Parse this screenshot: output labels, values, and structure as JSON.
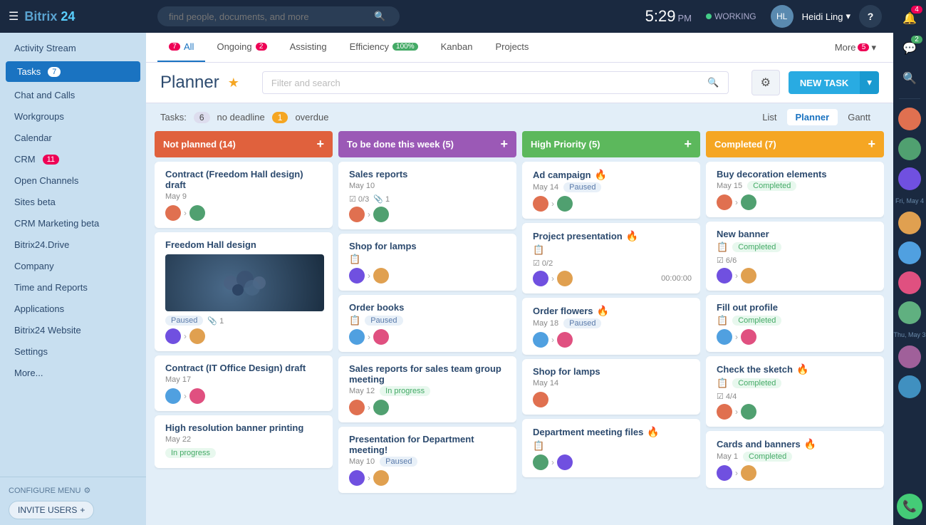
{
  "brand": {
    "name_part1": "Bitrix",
    "name_part2": "24"
  },
  "topbar": {
    "search_placeholder": "find people, documents, and more",
    "time": "5:29",
    "ampm": "PM",
    "status": "WORKING",
    "user_name": "Heidi Ling"
  },
  "sidebar": {
    "items": [
      {
        "label": "Activity Stream",
        "id": "activity-stream",
        "badge": null
      },
      {
        "label": "Tasks",
        "id": "tasks",
        "badge": "7"
      },
      {
        "label": "Chat and Calls",
        "id": "chat-and-calls",
        "badge": null
      },
      {
        "label": "Workgroups",
        "id": "workgroups",
        "badge": null
      },
      {
        "label": "Calendar",
        "id": "calendar",
        "badge": null
      },
      {
        "label": "CRM",
        "id": "crm",
        "badge": "11"
      },
      {
        "label": "Open Channels",
        "id": "open-channels",
        "badge": null
      },
      {
        "label": "Sites beta",
        "id": "sites",
        "badge": null
      },
      {
        "label": "CRM Marketing beta",
        "id": "crm-marketing",
        "badge": null
      },
      {
        "label": "Bitrix24.Drive",
        "id": "bitrix24-drive",
        "badge": null
      },
      {
        "label": "Company",
        "id": "company",
        "badge": null
      },
      {
        "label": "Time and Reports",
        "id": "time-and-reports",
        "badge": null
      },
      {
        "label": "Applications",
        "id": "applications",
        "badge": null
      },
      {
        "label": "Bitrix24 Website",
        "id": "bitrix24-website",
        "badge": null
      },
      {
        "label": "Settings",
        "id": "settings",
        "badge": null
      },
      {
        "label": "More...",
        "id": "more",
        "badge": null
      }
    ],
    "configure_menu": "CONFIGURE MENU",
    "invite_users": "INVITE USERS"
  },
  "tabs": [
    {
      "label": "All",
      "id": "all",
      "badge": "7",
      "badge_color": "red",
      "active": true
    },
    {
      "label": "Ongoing",
      "id": "ongoing",
      "badge": "2",
      "badge_color": "red"
    },
    {
      "label": "Assisting",
      "id": "assisting",
      "badge": null
    },
    {
      "label": "Efficiency",
      "id": "efficiency",
      "badge": "100%",
      "badge_color": "green"
    },
    {
      "label": "Kanban",
      "id": "kanban",
      "badge": null
    },
    {
      "label": "Projects",
      "id": "projects",
      "badge": null
    },
    {
      "label": "More",
      "id": "more",
      "badge": "5",
      "badge_color": "red"
    }
  ],
  "planner": {
    "title": "Planner",
    "filter_placeholder": "Filter and search",
    "new_task_label": "NEW TASK"
  },
  "stats": {
    "tasks_label": "Tasks:",
    "no_deadline": "6",
    "no_deadline_label": "no deadline",
    "overdue": "1",
    "overdue_label": "overdue"
  },
  "view_tabs": [
    "List",
    "Planner",
    "Gantt"
  ],
  "columns": [
    {
      "id": "not-planned",
      "title": "Not planned",
      "count": 14,
      "color": "col-orange",
      "cards": [
        {
          "id": "c1",
          "title": "Contract (Freedom Hall design) draft",
          "date": "May 9",
          "status": null,
          "avatars": [
            "av1",
            "av2"
          ],
          "has_arrow": true,
          "check": null,
          "clip": null,
          "timer": null,
          "fire": false,
          "img": false
        },
        {
          "id": "c2",
          "title": "Freedom Hall design",
          "date": "",
          "status": "Paused",
          "status_type": "paused",
          "avatars": [
            "av2",
            "av3"
          ],
          "has_arrow": true,
          "check": null,
          "clip": "1",
          "timer": null,
          "fire": false,
          "img": true
        },
        {
          "id": "c3",
          "title": "Contract (IT Office Design) draft",
          "date": "May 17",
          "status": null,
          "avatars": [
            "av4",
            "av5"
          ],
          "has_arrow": true,
          "check": null,
          "clip": null,
          "timer": null,
          "fire": false,
          "img": false
        },
        {
          "id": "c4",
          "title": "High resolution banner printing",
          "date": "May 22",
          "status": "In progress",
          "status_type": "progress",
          "avatars": [],
          "has_arrow": false,
          "check": null,
          "clip": null,
          "timer": null,
          "fire": false,
          "img": false
        }
      ]
    },
    {
      "id": "to-be-done",
      "title": "To be done this week",
      "count": 5,
      "color": "col-purple",
      "cards": [
        {
          "id": "c5",
          "title": "Sales reports",
          "date": "May 10",
          "status": null,
          "avatars": [
            "av1",
            "av2"
          ],
          "has_arrow": true,
          "check": "0/3",
          "clip": "1",
          "timer": null,
          "fire": false,
          "img": false
        },
        {
          "id": "c6",
          "title": "Shop for lamps",
          "date": "",
          "status": null,
          "avatars": [
            "av3",
            "av4"
          ],
          "has_arrow": true,
          "check": null,
          "clip": null,
          "timer": null,
          "fire": false,
          "img": false
        },
        {
          "id": "c7",
          "title": "Order books",
          "date": "",
          "status": "Paused",
          "status_type": "paused",
          "avatars": [
            "av5",
            "av6"
          ],
          "has_arrow": true,
          "check": null,
          "clip": null,
          "timer": null,
          "fire": false,
          "img": false
        },
        {
          "id": "c8",
          "title": "Sales reports for sales team group meeting",
          "date": "May 12",
          "status": "In progress",
          "status_type": "progress",
          "avatars": [
            "av1",
            "av2"
          ],
          "has_arrow": true,
          "check": null,
          "clip": null,
          "timer": null,
          "fire": false,
          "img": false
        },
        {
          "id": "c9",
          "title": "Presentation for Department meeting!",
          "date": "May 10",
          "status": "Paused",
          "status_type": "paused",
          "avatars": [
            "av3",
            "av4"
          ],
          "has_arrow": true,
          "check": null,
          "clip": null,
          "timer": null,
          "fire": false,
          "img": false
        }
      ]
    },
    {
      "id": "high-priority",
      "title": "High Priority",
      "count": 5,
      "color": "col-green",
      "cards": [
        {
          "id": "c10",
          "title": "Ad campaign",
          "date": "May 14",
          "status": "Paused",
          "status_type": "paused",
          "avatars": [
            "av1",
            "av2"
          ],
          "has_arrow": true,
          "check": null,
          "clip": null,
          "timer": null,
          "fire": true,
          "img": false
        },
        {
          "id": "c11",
          "title": "Project presentation",
          "date": "",
          "status": null,
          "avatars": [
            "av3",
            "av4"
          ],
          "has_arrow": true,
          "check": "0/2",
          "clip": null,
          "timer": "00:00:00",
          "fire": true,
          "img": false
        },
        {
          "id": "c12",
          "title": "Order flowers",
          "date": "May 18",
          "status": "Paused",
          "status_type": "paused",
          "avatars": [
            "av5",
            "av6"
          ],
          "has_arrow": true,
          "check": null,
          "clip": null,
          "timer": null,
          "fire": true,
          "img": false
        },
        {
          "id": "c13",
          "title": "Shop for lamps",
          "date": "May 14",
          "status": null,
          "avatars": [
            "av1"
          ],
          "has_arrow": false,
          "check": null,
          "clip": null,
          "timer": null,
          "fire": false,
          "img": false
        },
        {
          "id": "c14",
          "title": "Department meeting files",
          "date": "",
          "status": null,
          "avatars": [
            "av2",
            "av3"
          ],
          "has_arrow": true,
          "check": null,
          "clip": null,
          "timer": null,
          "fire": true,
          "img": false
        }
      ]
    },
    {
      "id": "completed",
      "title": "Completed",
      "count": 7,
      "color": "col-yellow",
      "cards": [
        {
          "id": "c15",
          "title": "Buy decoration elements",
          "date": "May 15",
          "status": "Completed",
          "status_type": "completed",
          "avatars": [
            "av1",
            "av2"
          ],
          "has_arrow": true,
          "check": null,
          "clip": null,
          "timer": null,
          "fire": false,
          "img": false
        },
        {
          "id": "c16",
          "title": "New banner",
          "date": "",
          "status": "Completed",
          "status_type": "completed",
          "avatars": [
            "av3",
            "av4"
          ],
          "has_arrow": true,
          "check": "6/6",
          "clip": null,
          "timer": null,
          "fire": false,
          "img": false
        },
        {
          "id": "c17",
          "title": "Fill out profile",
          "date": "",
          "status": "Completed",
          "status_type": "completed",
          "avatars": [
            "av5",
            "av6"
          ],
          "has_arrow": true,
          "check": null,
          "clip": null,
          "timer": null,
          "fire": false,
          "img": false
        },
        {
          "id": "c18",
          "title": "Check the sketch",
          "date": "",
          "status": "Completed",
          "status_type": "completed",
          "avatars": [
            "av1",
            "av2"
          ],
          "has_arrow": true,
          "check": "4/4",
          "clip": null,
          "timer": null,
          "fire": true,
          "img": false
        },
        {
          "id": "c19",
          "title": "Cards and banners",
          "date": "May 1",
          "status": "Completed",
          "status_type": "completed",
          "avatars": [
            "av3",
            "av4"
          ],
          "has_arrow": true,
          "check": null,
          "clip": null,
          "timer": null,
          "fire": true,
          "img": false
        }
      ]
    }
  ],
  "right_panel": {
    "date1": "Fri, May 4",
    "date2": "Thu, May 3"
  }
}
